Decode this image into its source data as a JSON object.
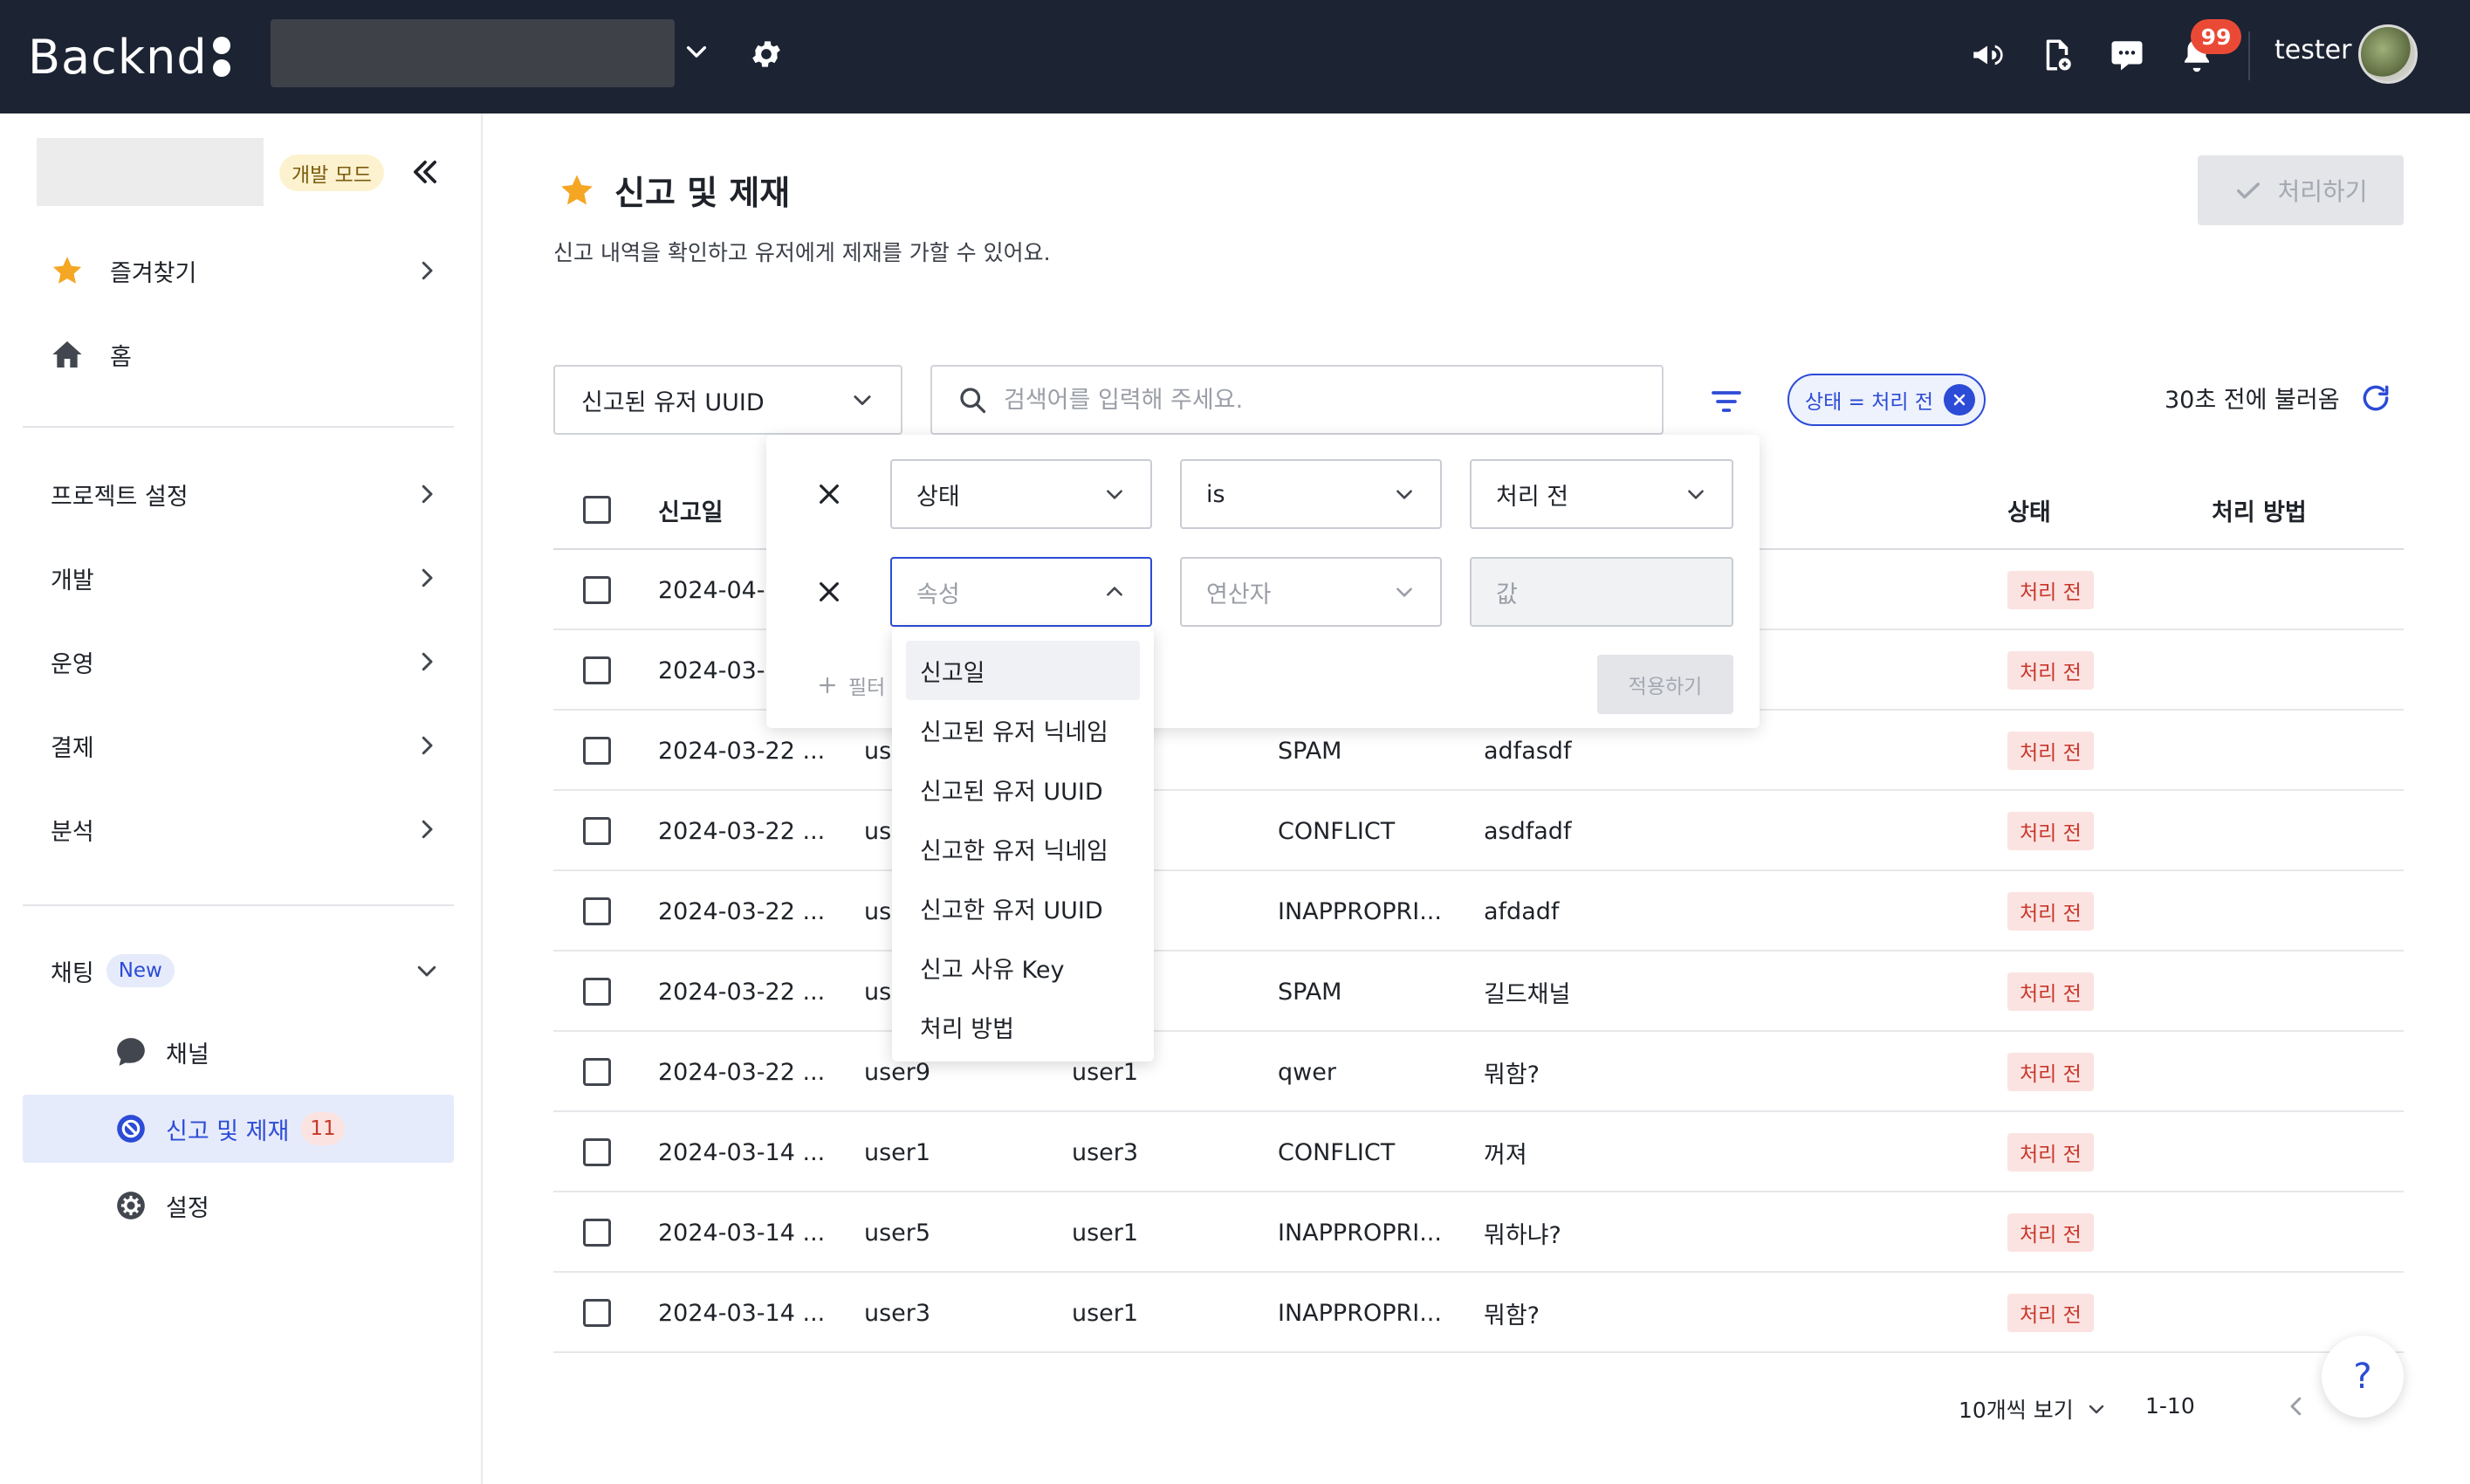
{
  "topbar": {
    "logo": "Backnd",
    "notification_count": "99",
    "username": "tester"
  },
  "sidebar": {
    "dev_mode": "개발 모드",
    "favorites": "즐겨찾기",
    "home": "홈",
    "sections": [
      {
        "label": "프로젝트 설정"
      },
      {
        "label": "개발"
      },
      {
        "label": "운영"
      },
      {
        "label": "결제"
      },
      {
        "label": "분석"
      }
    ],
    "chatting": {
      "label": "채팅",
      "new_badge": "New",
      "items": [
        {
          "label": "채널"
        },
        {
          "label": "신고 및 제재",
          "count": "11"
        },
        {
          "label": "설정"
        }
      ]
    }
  },
  "page": {
    "title": "신고 및 제재",
    "description": "신고 내역을 확인하고 유저에게 제재를 가할 수 있어요.",
    "process_button": "처리하기"
  },
  "toolbar": {
    "search_field": "신고된 유저 UUID",
    "search_placeholder": "검색어를 입력해 주세요.",
    "filter_chip": "상태 = 처리 전",
    "reload_text": "30초 전에 불러옴"
  },
  "table": {
    "columns": [
      "신고일",
      "상태",
      "처리 방법"
    ],
    "rows": [
      {
        "date": "2024-04-",
        "reported": "",
        "reporter": "",
        "reason": "",
        "message": "",
        "status": "처리 전"
      },
      {
        "date": "2024-03-",
        "reported": "",
        "reporter": "",
        "reason": "",
        "message": "",
        "status": "처리 전"
      },
      {
        "date": "2024-03-22 ...",
        "reported": "us",
        "reporter": "",
        "reason": "SPAM",
        "message": "adfasdf",
        "status": "처리 전"
      },
      {
        "date": "2024-03-22 ...",
        "reported": "us",
        "reporter": "",
        "reason": "CONFLICT",
        "message": "asdfadf",
        "status": "처리 전"
      },
      {
        "date": "2024-03-22 ...",
        "reported": "us",
        "reporter": "",
        "reason": "INAPPROPRI...",
        "message": "afdadf",
        "status": "처리 전"
      },
      {
        "date": "2024-03-22 ...",
        "reported": "us",
        "reporter": "",
        "reason": "SPAM",
        "message": "길드채널",
        "status": "처리 전"
      },
      {
        "date": "2024-03-22 ...",
        "reported": "user9",
        "reporter": "user1",
        "reason": "qwer",
        "message": "뭐함?",
        "status": "처리 전"
      },
      {
        "date": "2024-03-14 ...",
        "reported": "user1",
        "reporter": "user3",
        "reason": "CONFLICT",
        "message": "꺼져",
        "status": "처리 전"
      },
      {
        "date": "2024-03-14 ...",
        "reported": "user5",
        "reporter": "user1",
        "reason": "INAPPROPRI...",
        "message": "뭐하냐?",
        "status": "처리 전"
      },
      {
        "date": "2024-03-14 ...",
        "reported": "user3",
        "reporter": "user1",
        "reason": "INAPPROPRI...",
        "message": "뭐함?",
        "status": "처리 전"
      }
    ]
  },
  "filter_popover": {
    "rows": [
      {
        "attribute": "상태",
        "operator": "is",
        "value": "처리 전"
      },
      {
        "attribute_placeholder": "속성",
        "operator_placeholder": "연산자",
        "value_placeholder": "값"
      }
    ],
    "add_filter": "필터",
    "apply_button": "적용하기"
  },
  "attribute_dropdown": {
    "options": [
      "신고일",
      "신고된 유저 닉네임",
      "신고된 유저 UUID",
      "신고한 유저 닉네임",
      "신고한 유저 UUID",
      "신고 사유 Key",
      "처리 방법"
    ]
  },
  "pagination": {
    "page_size": "10개씩 보기",
    "range": "1-10"
  },
  "help": "?",
  "colors": {
    "topbar": "#1c2333",
    "accent": "#2c4bd6",
    "status_bg": "#fbe3e1",
    "status_text": "#c8372a",
    "star": "#f5a623"
  }
}
